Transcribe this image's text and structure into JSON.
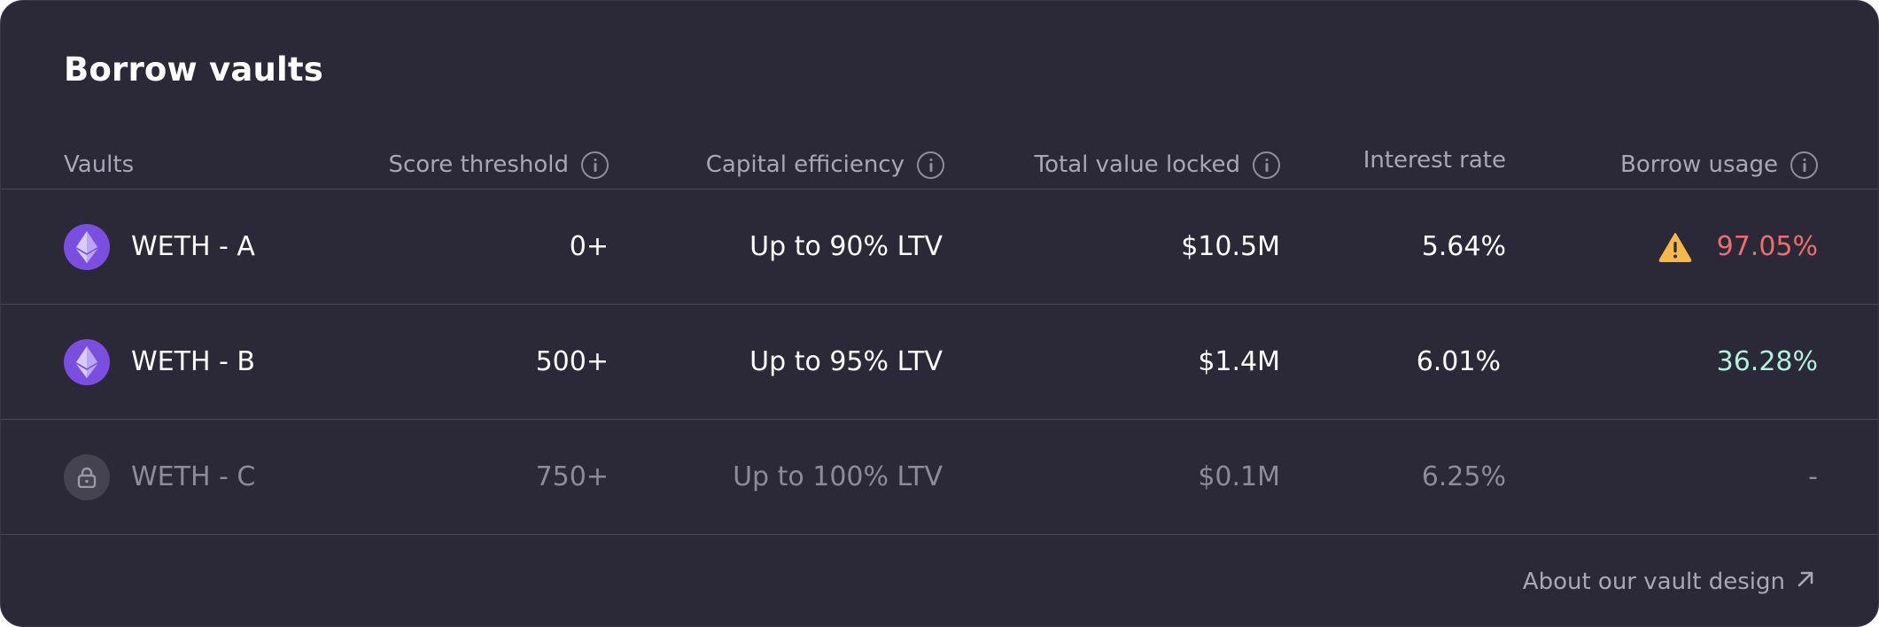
{
  "title": "Borrow vaults",
  "columns": {
    "vaults": "Vaults",
    "score": "Score threshold",
    "capital": "Capital efficiency",
    "tvl": "Total value locked",
    "interest": "Interest rate",
    "usage": "Borrow usage"
  },
  "rows": [
    {
      "name": "WETH - A",
      "score": "0+",
      "capital": "Up to 90% LTV",
      "tvl": "$10.5M",
      "interest": "5.64%",
      "usage": "97.05%",
      "icon": "ethereum-icon",
      "usage_status": "warning"
    },
    {
      "name": "WETH - B",
      "score": "500+",
      "capital": "Up to 95% LTV",
      "tvl": "$1.4M",
      "interest": "6.01%",
      "usage": "36.28%",
      "icon": "ethereum-icon",
      "usage_status": "ok"
    },
    {
      "name": "WETH - C",
      "score": "750+",
      "capital": "Up to 100% LTV",
      "tvl": "$0.1M",
      "interest": "6.25%",
      "usage": "-",
      "icon": "lock-icon",
      "usage_status": "locked"
    }
  ],
  "footer": {
    "link_label": "About our vault design",
    "icon": "arrow-up-right-icon"
  },
  "colors": {
    "background": "#2b2937",
    "warning": "#f5b84d",
    "usage_red": "#ec6e6e",
    "usage_green": "#b2f0dc",
    "ethereum": "#7a4fe0"
  }
}
